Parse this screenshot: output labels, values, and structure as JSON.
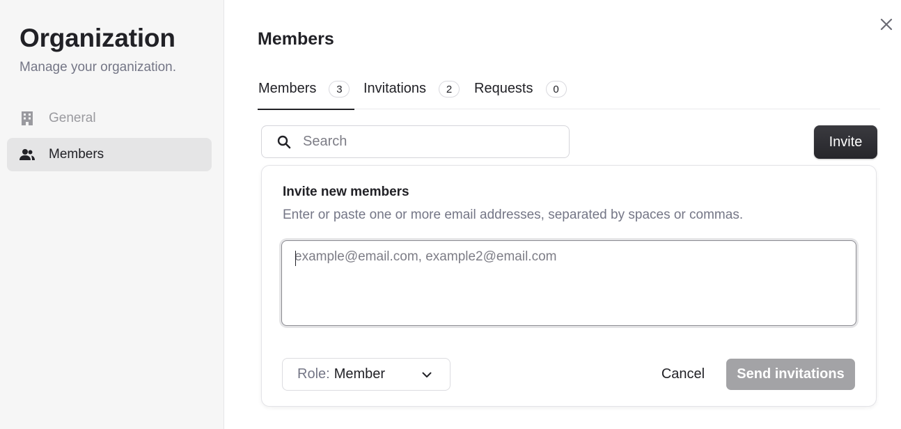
{
  "sidebar": {
    "title": "Organization",
    "subtitle": "Manage your organization.",
    "items": [
      {
        "label": "General",
        "icon": "building-icon",
        "active": false
      },
      {
        "label": "Members",
        "icon": "users-icon",
        "active": true
      }
    ]
  },
  "main": {
    "title": "Members",
    "tabs": [
      {
        "label": "Members",
        "count": "3",
        "active": true
      },
      {
        "label": "Invitations",
        "count": "2",
        "active": false
      },
      {
        "label": "Requests",
        "count": "0",
        "active": false
      }
    ],
    "search": {
      "placeholder": "Search",
      "value": ""
    },
    "invite_button": "Invite"
  },
  "invite_card": {
    "title": "Invite new members",
    "description": "Enter or paste one or more email addresses, separated by spaces or commas.",
    "emails": {
      "placeholder": "example@email.com, example2@email.com",
      "value": ""
    },
    "role": {
      "prefix": "Role:",
      "value": "Member"
    },
    "cancel_label": "Cancel",
    "send_label": "Send invitations"
  },
  "colors": {
    "primary_button": "#2d2d32",
    "disabled_button": "#a3a3a6",
    "sidebar_bg": "#f6f6f6",
    "active_nav_bg": "#e5e5e6"
  }
}
